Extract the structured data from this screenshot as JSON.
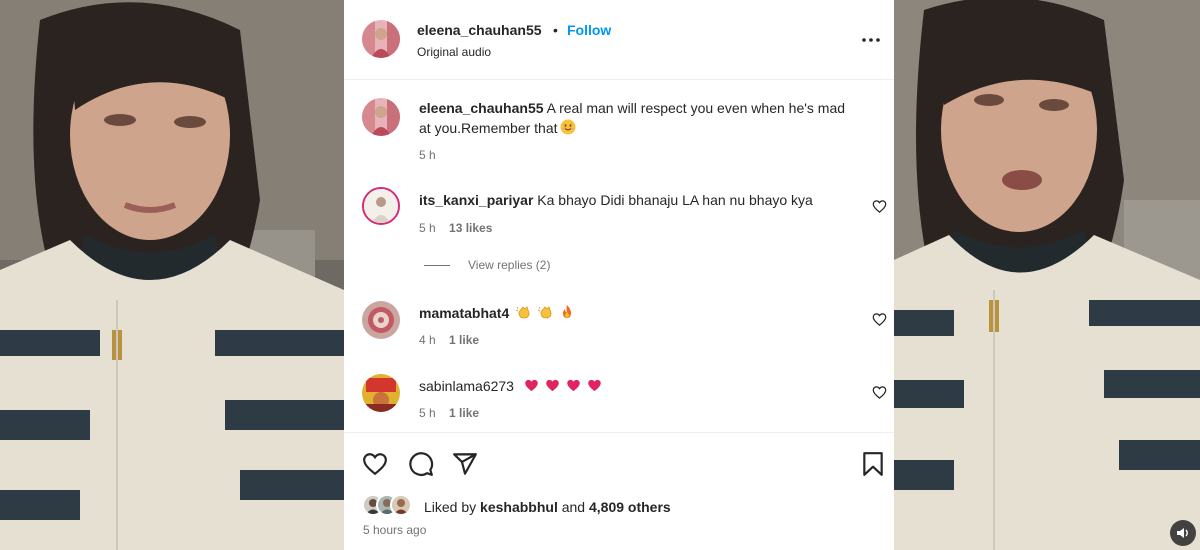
{
  "post": {
    "header": {
      "username": "eleena_chauhan55",
      "separator": "•",
      "follow_label": "Follow",
      "audio_label": "Original audio"
    },
    "caption": {
      "username": "eleena_chauhan55",
      "text": "A real man will respect you even when he's mad at you.Remember that",
      "emoji": "smiling-face-emoji",
      "time": "5 h"
    },
    "comments": [
      {
        "username": "its_kanxi_pariyar",
        "text": "Ka bhayo Didi bhanaju LA han nu bhayo kya",
        "time": "5 h",
        "likes": "13 likes"
      },
      {
        "username": "mamatabhat4",
        "text": "",
        "emojis": [
          "clapping-hands-emoji",
          "clapping-hands-emoji",
          "fire-emoji"
        ],
        "time": "4 h",
        "likes": "1 like"
      },
      {
        "username": "sabinlama6273",
        "text": "",
        "emojis": [
          "red-heart-emoji",
          "red-heart-emoji",
          "red-heart-emoji",
          "red-heart-emoji"
        ],
        "time": "5 h",
        "likes": "1 like"
      }
    ],
    "view_replies_label": "View replies (2)",
    "liked_by": {
      "prefix": "Liked by",
      "user": "keshabbhul",
      "middle": "and",
      "count": "4,809 others"
    },
    "timestamp": "5 hours ago"
  },
  "icons": {
    "more": "more-options-icon",
    "like": "heart-icon",
    "comment": "comment-icon",
    "share": "send-icon",
    "save": "bookmark-icon",
    "mute": "speaker-icon"
  },
  "colors": {
    "follow": "#0095f6",
    "meta": "#737373",
    "text": "#262626",
    "heart_emoji": "#e0245e"
  }
}
